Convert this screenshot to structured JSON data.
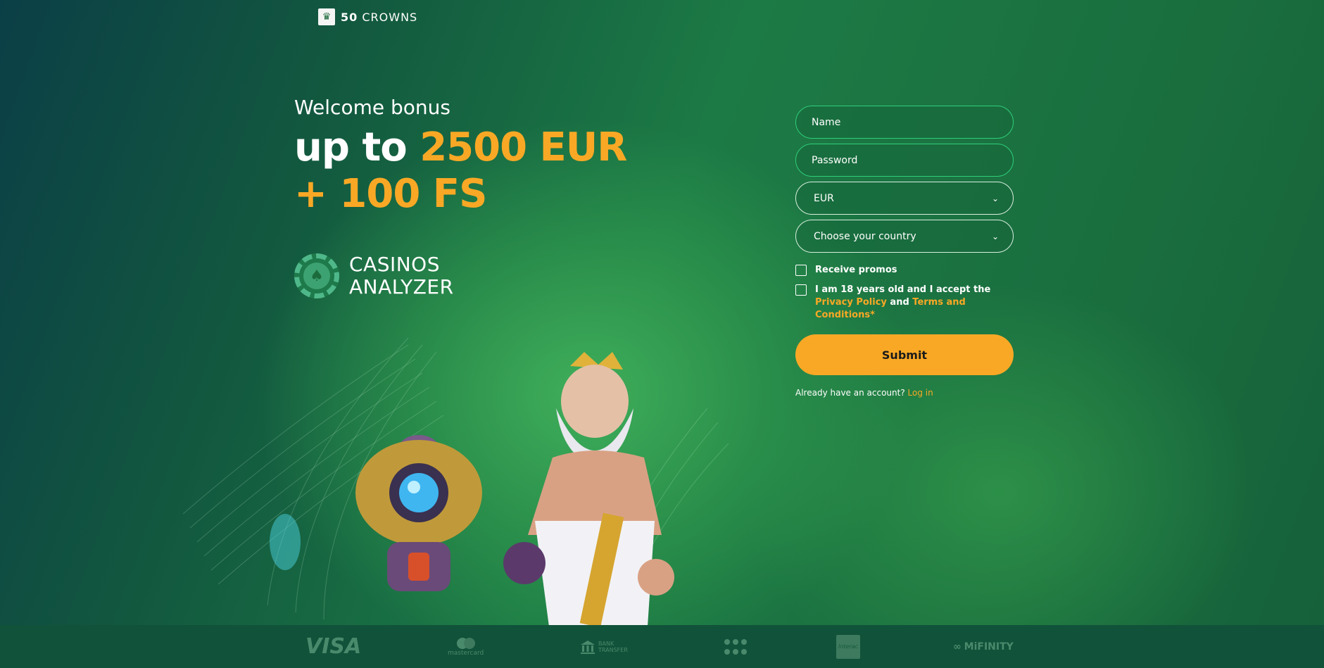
{
  "brand": {
    "logo_icon": "crown-icon",
    "number": "50",
    "name": "CROWNS"
  },
  "promo": {
    "welcome": "Welcome bonus",
    "line1_prefix": "up to ",
    "line1_amount": "2500 EUR",
    "line2": "+ 100 FS"
  },
  "partner": {
    "icon": "spade-chip-icon",
    "line1": "CASINOS",
    "line2": "ANALYZER"
  },
  "form": {
    "name_placeholder": "Name",
    "password_placeholder": "Password",
    "currency": "EUR",
    "country": "Choose your country",
    "receive_promos": "Receive promos",
    "accept_prefix": "I am 18 years old and I accept the ",
    "privacy_link": "Privacy Policy",
    "and": " and ",
    "terms_link": "Terms and Conditions*",
    "submit": "Submit",
    "login_prompt": "Already have an account? ",
    "login_link": "Log in"
  },
  "payments": {
    "visa": "VISA",
    "mastercard": "mastercard",
    "bank_line1": "BANK",
    "bank_line2": "TRANSFER",
    "interac": "Interac",
    "mifinity": "MiFINITY"
  },
  "colors": {
    "accent": "#f9a825",
    "field_border": "#2fcf7a",
    "footer": "#11523a"
  }
}
